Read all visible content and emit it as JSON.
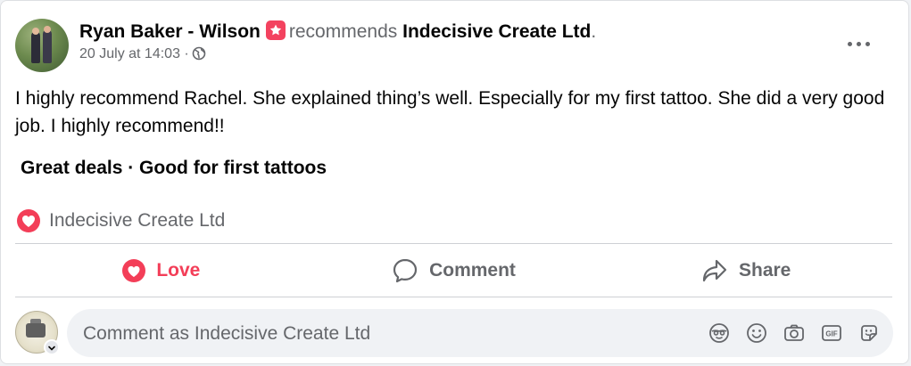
{
  "post": {
    "author": "Ryan Baker - Wilson",
    "verb": "recommends",
    "page": "Indecisive Create Ltd",
    "period": ".",
    "date": "20 July at 14:03",
    "separator": "·",
    "privacy_icon": "globe-icon",
    "body": "I highly recommend Rachel. She explained thing’s well. Especially for my first tattoo. She did a very good job. I highly recommend!!",
    "tags": "Great deals · Good for first tattoos"
  },
  "reactions": {
    "icon": "love-reaction-icon",
    "names": "Indecisive Create Ltd"
  },
  "actions": {
    "love": "Love",
    "comment": "Comment",
    "share": "Share"
  },
  "composer": {
    "placeholder": "Comment as Indecisive Create Ltd",
    "icons": [
      "avatar-sticker-icon",
      "emoji-icon",
      "camera-icon",
      "gif-icon",
      "sticker-icon"
    ]
  },
  "colors": {
    "love": "#f33e58",
    "recommend_badge": "#f3425f",
    "secondary_text": "#65676b",
    "primary_text": "#050505"
  }
}
